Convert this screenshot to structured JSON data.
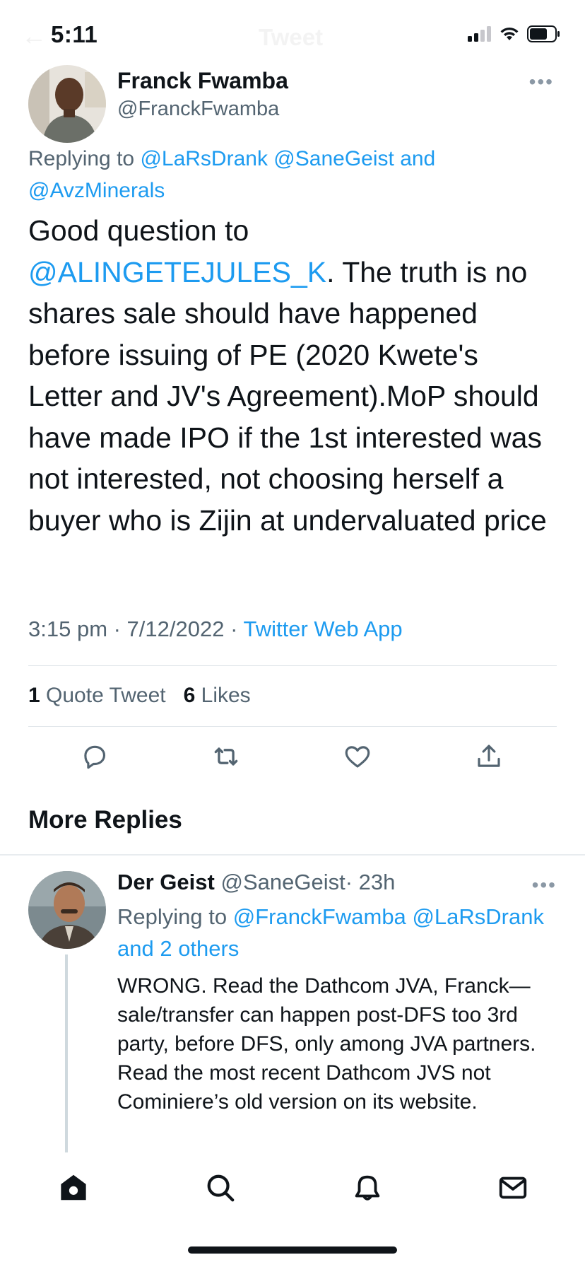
{
  "status_bar": {
    "time": "5:11"
  },
  "header": {
    "back_icon": "arrow-left-icon",
    "title": "Tweet"
  },
  "tweet": {
    "author_name": "Franck Fwamba",
    "author_handle": "@FranckFwamba",
    "replying_prefix": "Replying to",
    "replying_users": [
      "@LaRsDrank",
      "@SaneGeist",
      "and",
      "@AvzMinerals"
    ],
    "body_line1": "Good question to",
    "body_mention": "@ALINGETEJULES_K",
    "body_rest": ". The truth is no shares sale should have happened before issuing of PE (2020 Kwete's Letter and JV's Agreement).MoP should have made IPO if the 1st interested was not interested, not choosing herself a buyer who is Zijin at undervaluated price",
    "meta_time": "3:15 pm · 7/12/2022 ·",
    "meta_source": "Twitter Web App",
    "quote_count": "1",
    "quote_label": "Quote Tweet",
    "like_count": "6",
    "like_label": "Likes",
    "actions": [
      "reply-icon",
      "retweet-icon",
      "like-icon",
      "share-icon"
    ]
  },
  "more_replies": {
    "title": "More Replies"
  },
  "reply": {
    "name": "Der Geist",
    "handle": "@SaneGeist",
    "time": "· 23h",
    "replying_prefix": "Replying to",
    "replying_users": [
      "@FranckFwamba",
      "@LaRsDrank",
      "and 2 others"
    ],
    "body": "WRONG. Read the Dathcom JVA, Franck—sale/transfer can happen post-DFS too 3rd party, before DFS, only among JVA partners. Read the most recent Dathcom JVS not Cominiere’s old version on its website."
  },
  "tabbar": {
    "items": [
      "home-icon",
      "search-icon",
      "notifications-icon",
      "messages-icon"
    ]
  },
  "colors": {
    "accent": "#1d9bf0",
    "text": "#0f1419",
    "secondary": "#536471"
  }
}
